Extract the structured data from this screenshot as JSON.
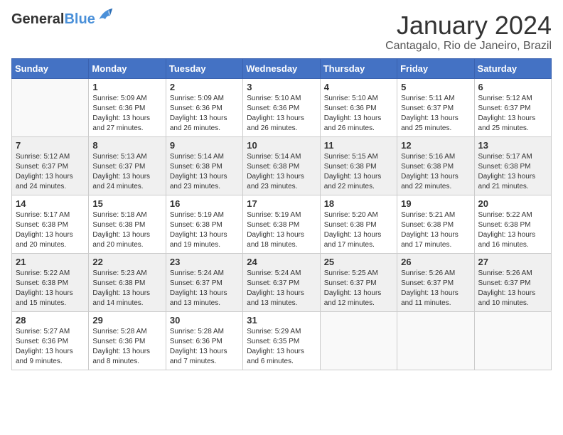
{
  "logo": {
    "general": "General",
    "blue": "Blue"
  },
  "header": {
    "month": "January 2024",
    "location": "Cantagalo, Rio de Janeiro, Brazil"
  },
  "days_of_week": [
    "Sunday",
    "Monday",
    "Tuesday",
    "Wednesday",
    "Thursday",
    "Friday",
    "Saturday"
  ],
  "weeks": [
    [
      {
        "day": "",
        "info": ""
      },
      {
        "day": "1",
        "info": "Sunrise: 5:09 AM\nSunset: 6:36 PM\nDaylight: 13 hours and 27 minutes."
      },
      {
        "day": "2",
        "info": "Sunrise: 5:09 AM\nSunset: 6:36 PM\nDaylight: 13 hours and 26 minutes."
      },
      {
        "day": "3",
        "info": "Sunrise: 5:10 AM\nSunset: 6:36 PM\nDaylight: 13 hours and 26 minutes."
      },
      {
        "day": "4",
        "info": "Sunrise: 5:10 AM\nSunset: 6:36 PM\nDaylight: 13 hours and 26 minutes."
      },
      {
        "day": "5",
        "info": "Sunrise: 5:11 AM\nSunset: 6:37 PM\nDaylight: 13 hours and 25 minutes."
      },
      {
        "day": "6",
        "info": "Sunrise: 5:12 AM\nSunset: 6:37 PM\nDaylight: 13 hours and 25 minutes."
      }
    ],
    [
      {
        "day": "7",
        "info": "Sunrise: 5:12 AM\nSunset: 6:37 PM\nDaylight: 13 hours and 24 minutes."
      },
      {
        "day": "8",
        "info": "Sunrise: 5:13 AM\nSunset: 6:37 PM\nDaylight: 13 hours and 24 minutes."
      },
      {
        "day": "9",
        "info": "Sunrise: 5:14 AM\nSunset: 6:38 PM\nDaylight: 13 hours and 23 minutes."
      },
      {
        "day": "10",
        "info": "Sunrise: 5:14 AM\nSunset: 6:38 PM\nDaylight: 13 hours and 23 minutes."
      },
      {
        "day": "11",
        "info": "Sunrise: 5:15 AM\nSunset: 6:38 PM\nDaylight: 13 hours and 22 minutes."
      },
      {
        "day": "12",
        "info": "Sunrise: 5:16 AM\nSunset: 6:38 PM\nDaylight: 13 hours and 22 minutes."
      },
      {
        "day": "13",
        "info": "Sunrise: 5:17 AM\nSunset: 6:38 PM\nDaylight: 13 hours and 21 minutes."
      }
    ],
    [
      {
        "day": "14",
        "info": "Sunrise: 5:17 AM\nSunset: 6:38 PM\nDaylight: 13 hours and 20 minutes."
      },
      {
        "day": "15",
        "info": "Sunrise: 5:18 AM\nSunset: 6:38 PM\nDaylight: 13 hours and 20 minutes."
      },
      {
        "day": "16",
        "info": "Sunrise: 5:19 AM\nSunset: 6:38 PM\nDaylight: 13 hours and 19 minutes."
      },
      {
        "day": "17",
        "info": "Sunrise: 5:19 AM\nSunset: 6:38 PM\nDaylight: 13 hours and 18 minutes."
      },
      {
        "day": "18",
        "info": "Sunrise: 5:20 AM\nSunset: 6:38 PM\nDaylight: 13 hours and 17 minutes."
      },
      {
        "day": "19",
        "info": "Sunrise: 5:21 AM\nSunset: 6:38 PM\nDaylight: 13 hours and 17 minutes."
      },
      {
        "day": "20",
        "info": "Sunrise: 5:22 AM\nSunset: 6:38 PM\nDaylight: 13 hours and 16 minutes."
      }
    ],
    [
      {
        "day": "21",
        "info": "Sunrise: 5:22 AM\nSunset: 6:38 PM\nDaylight: 13 hours and 15 minutes."
      },
      {
        "day": "22",
        "info": "Sunrise: 5:23 AM\nSunset: 6:38 PM\nDaylight: 13 hours and 14 minutes."
      },
      {
        "day": "23",
        "info": "Sunrise: 5:24 AM\nSunset: 6:37 PM\nDaylight: 13 hours and 13 minutes."
      },
      {
        "day": "24",
        "info": "Sunrise: 5:24 AM\nSunset: 6:37 PM\nDaylight: 13 hours and 13 minutes."
      },
      {
        "day": "25",
        "info": "Sunrise: 5:25 AM\nSunset: 6:37 PM\nDaylight: 13 hours and 12 minutes."
      },
      {
        "day": "26",
        "info": "Sunrise: 5:26 AM\nSunset: 6:37 PM\nDaylight: 13 hours and 11 minutes."
      },
      {
        "day": "27",
        "info": "Sunrise: 5:26 AM\nSunset: 6:37 PM\nDaylight: 13 hours and 10 minutes."
      }
    ],
    [
      {
        "day": "28",
        "info": "Sunrise: 5:27 AM\nSunset: 6:36 PM\nDaylight: 13 hours and 9 minutes."
      },
      {
        "day": "29",
        "info": "Sunrise: 5:28 AM\nSunset: 6:36 PM\nDaylight: 13 hours and 8 minutes."
      },
      {
        "day": "30",
        "info": "Sunrise: 5:28 AM\nSunset: 6:36 PM\nDaylight: 13 hours and 7 minutes."
      },
      {
        "day": "31",
        "info": "Sunrise: 5:29 AM\nSunset: 6:35 PM\nDaylight: 13 hours and 6 minutes."
      },
      {
        "day": "",
        "info": ""
      },
      {
        "day": "",
        "info": ""
      },
      {
        "day": "",
        "info": ""
      }
    ]
  ]
}
